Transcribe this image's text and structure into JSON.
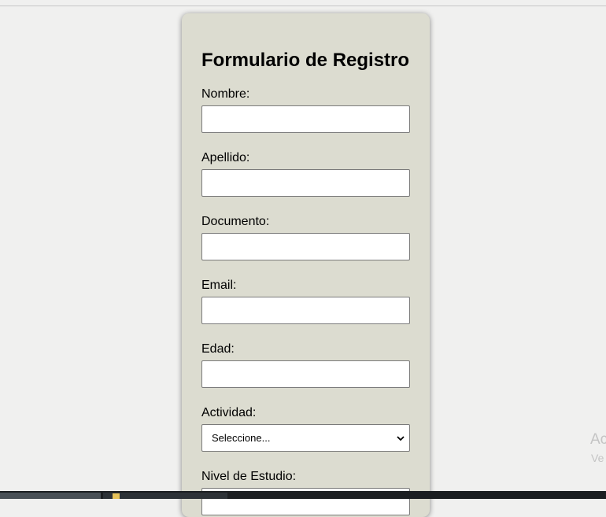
{
  "form": {
    "title": "Formulario de Registro",
    "fields": [
      {
        "label": "Nombre:",
        "value": ""
      },
      {
        "label": "Apellido:",
        "value": ""
      },
      {
        "label": "Documento:",
        "value": ""
      },
      {
        "label": "Email:",
        "value": ""
      },
      {
        "label": "Edad:",
        "value": ""
      }
    ],
    "actividad": {
      "label": "Actividad:",
      "selected": "Seleccione..."
    },
    "nivel_estudio": {
      "label": "Nivel de Estudio:"
    }
  },
  "watermark": {
    "line1": "Ac",
    "line2": "Ve"
  },
  "colors": {
    "card_bg": "#dcdcd0",
    "page_bg": "#f0f0ef",
    "taskbar": "#1c1f22"
  }
}
